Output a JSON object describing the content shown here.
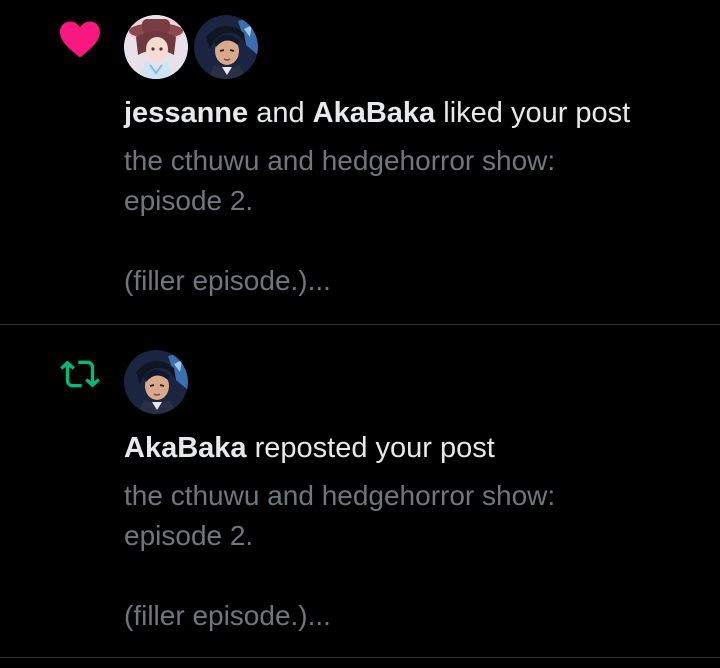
{
  "colors": {
    "background": "#000000",
    "primary_text": "#e7e9ea",
    "secondary_text": "#71767b",
    "like_accent": "#f91880",
    "repost_accent": "#00ba7c",
    "divider": "#2f3336"
  },
  "notifications": [
    {
      "type": "like",
      "icon": "heart-icon",
      "avatars": [
        "avatar-jessanne",
        "avatar-akabaka"
      ],
      "user_1": "jessanne",
      "joiner": "and",
      "user_2": "AkaBaka",
      "action": "liked your post",
      "snippet_line_1": "the cthuwu and hedgehorror show:",
      "snippet_line_2": "episode 2.",
      "snippet_line_3": "(filler episode.)..."
    },
    {
      "type": "repost",
      "icon": "repost-icon",
      "avatars": [
        "avatar-akabaka"
      ],
      "user_1": "AkaBaka",
      "action": "reposted your post",
      "snippet_line_1": "the cthuwu and hedgehorror show:",
      "snippet_line_2": "episode 2.",
      "snippet_line_3": "(filler episode.)..."
    }
  ]
}
